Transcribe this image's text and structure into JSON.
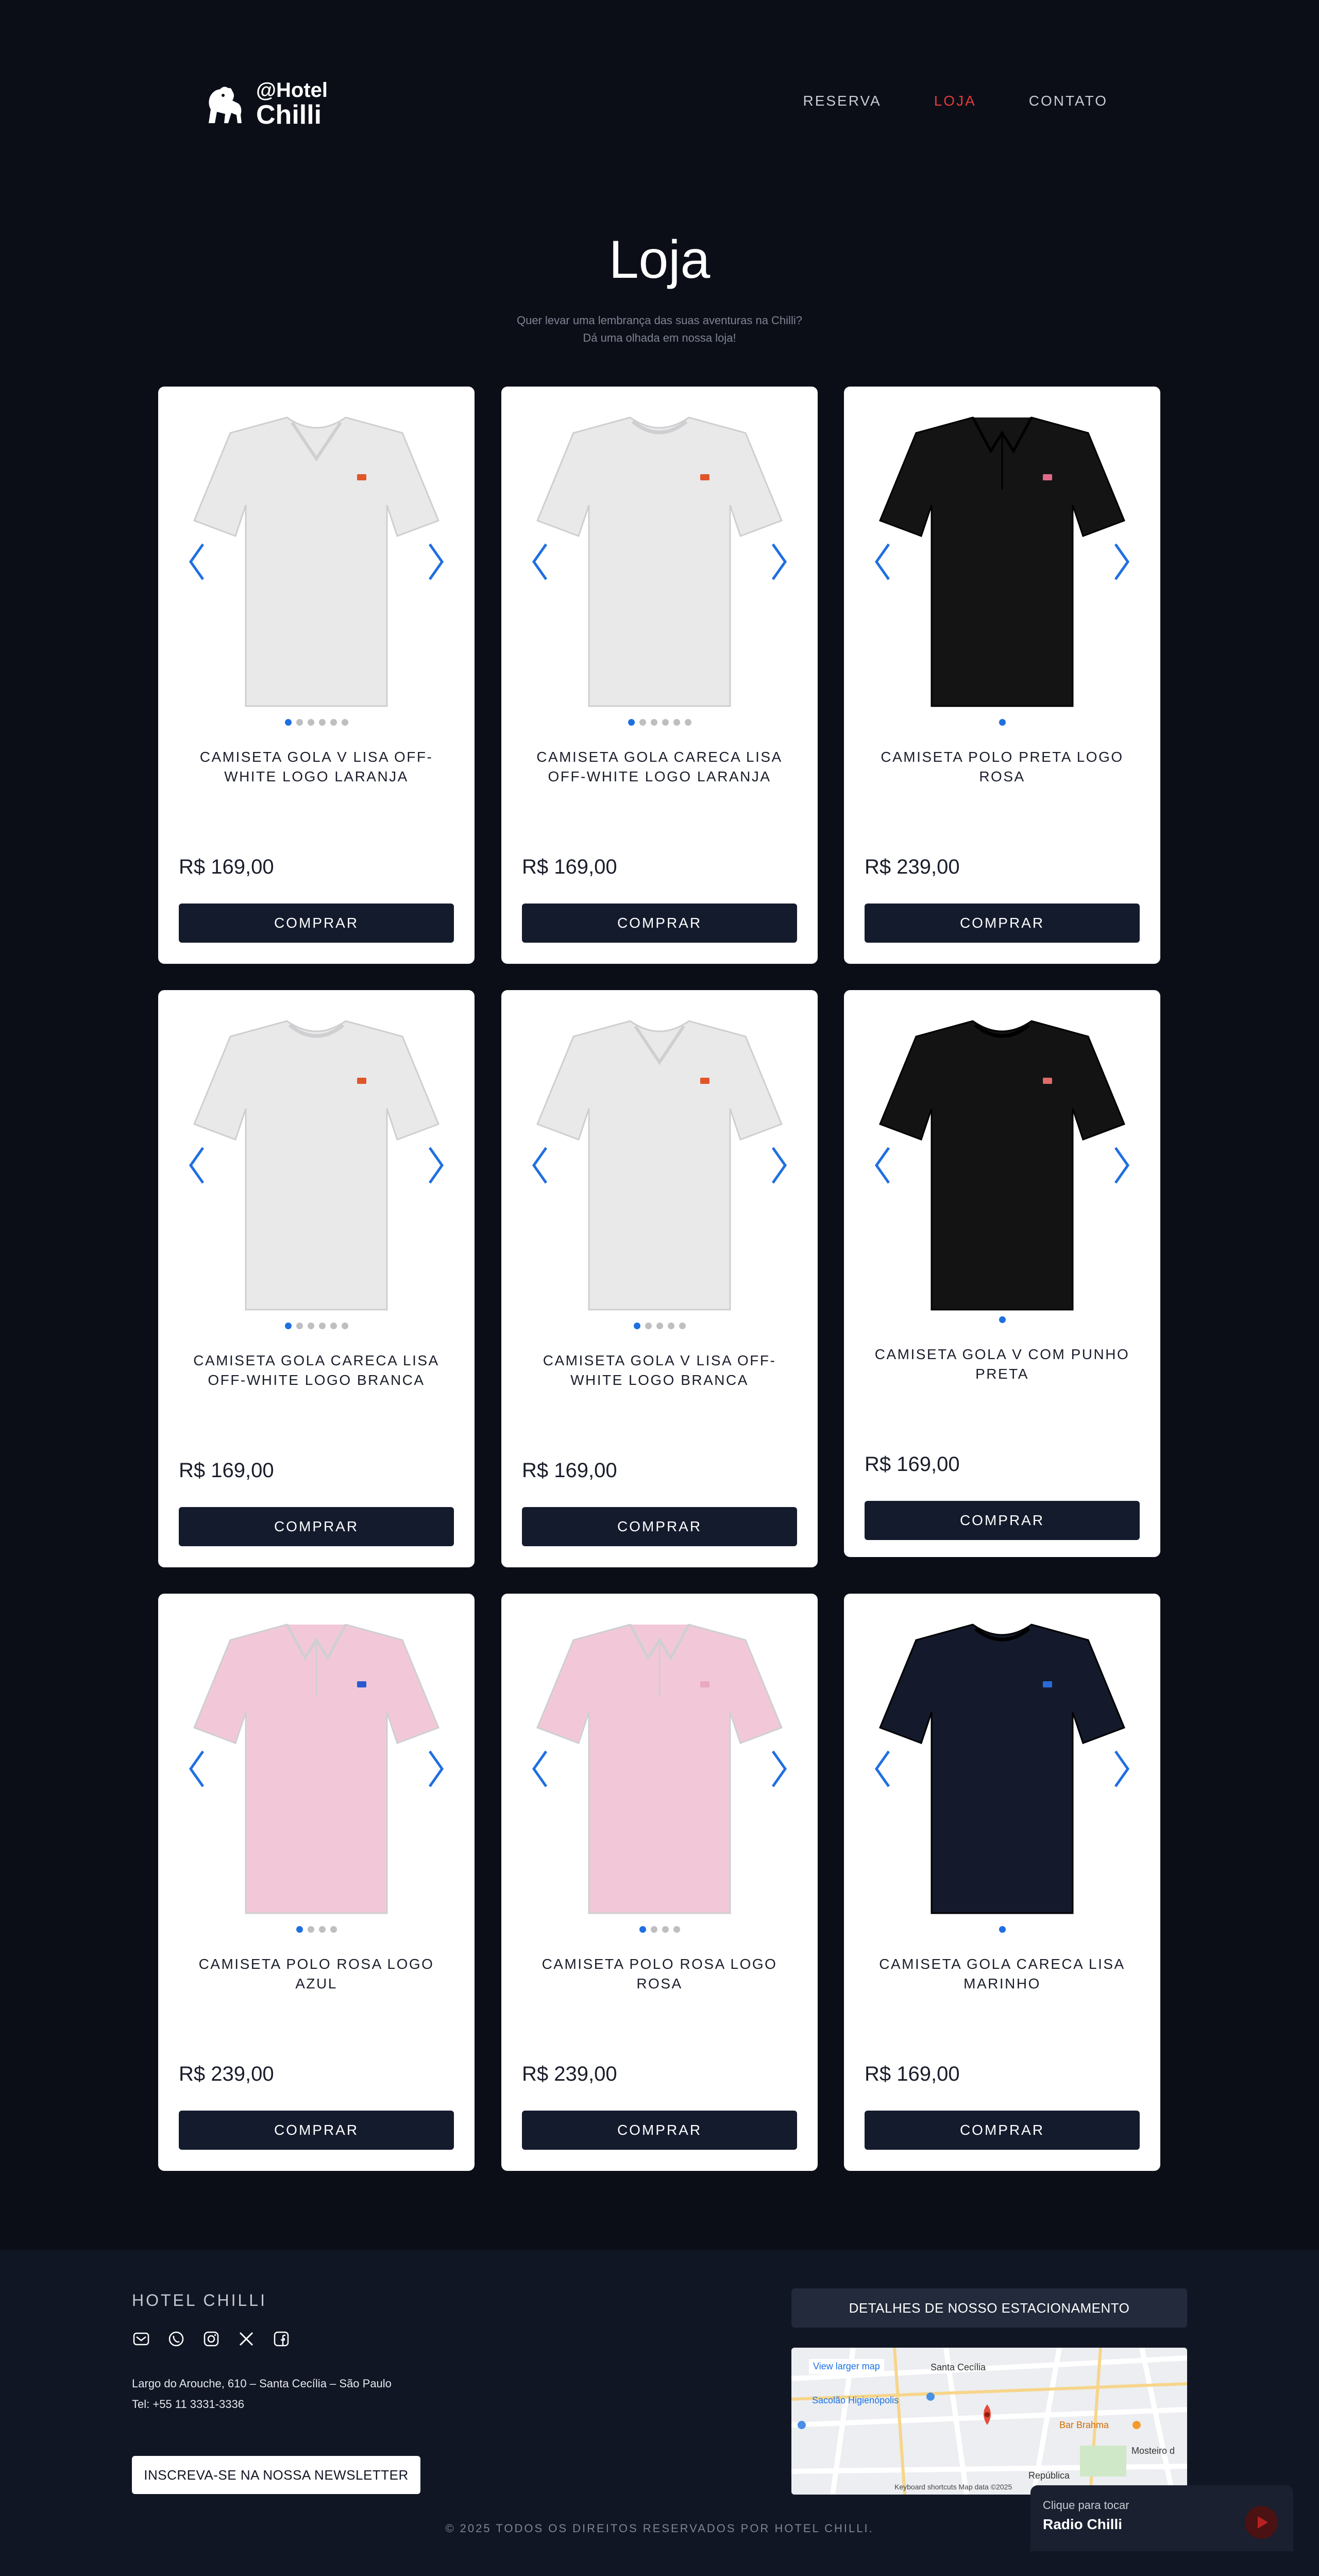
{
  "header": {
    "logo": {
      "line1": "@Hotel",
      "line2": "Chilli"
    },
    "nav": [
      {
        "label": "RESERVA",
        "active": false
      },
      {
        "label": "LOJA",
        "active": true
      },
      {
        "label": "CONTATO",
        "active": false
      }
    ]
  },
  "hero": {
    "title": "Loja",
    "subtitle_line1": "Quer levar uma lembrança das suas aventuras na Chilli?",
    "subtitle_line2": "Dá uma olhada em nossa loja!"
  },
  "products": [
    {
      "name": "CAMISETA GOLA V LISA OFF-WHITE LOGO LARANJA",
      "price": "R$ 169,00",
      "buy_label": "COMPRAR",
      "shirt_color": "#e9e9ea",
      "logo_color": "#e0562a",
      "dots": 6,
      "active_dot": 0
    },
    {
      "name": "CAMISETA GOLA CARECA LISA OFF-WHITE LOGO LARANJA",
      "price": "R$ 169,00",
      "buy_label": "COMPRAR",
      "shirt_color": "#e9e9ea",
      "logo_color": "#e0562a",
      "dots": 6,
      "active_dot": 0
    },
    {
      "name": "CAMISETA POLO PRETA LOGO ROSA",
      "price": "R$ 239,00",
      "buy_label": "COMPRAR",
      "shirt_color": "#141414",
      "logo_color": "#e06a8a",
      "dots": 1,
      "active_dot": 0
    },
    {
      "name": "CAMISETA GOLA CARECA LISA OFF-WHITE LOGO BRANCA",
      "price": "R$ 169,00",
      "buy_label": "COMPRAR",
      "shirt_color": "#e9e9ea",
      "logo_color": "#e0562a",
      "dots": 6,
      "active_dot": 0
    },
    {
      "name": "CAMISETA GOLA V LISA OFF-WHITE LOGO BRANCA",
      "price": "R$ 169,00",
      "buy_label": "COMPRAR",
      "shirt_color": "#e9e9ea",
      "logo_color": "#e0562a",
      "dots": 5,
      "active_dot": 0
    },
    {
      "name": "CAMISETA GOLA V COM PUNHO PRETA",
      "price": "R$ 169,00",
      "buy_label": "COMPRAR",
      "shirt_color": "#131313",
      "logo_color": "#e06a6a",
      "dots": 1,
      "active_dot": 0
    },
    {
      "name": "CAMISETA POLO ROSA LOGO AZUL",
      "price": "R$ 239,00",
      "buy_label": "COMPRAR",
      "shirt_color": "#f2c8d8",
      "logo_color": "#2a5ad0",
      "dots": 4,
      "active_dot": 0
    },
    {
      "name": "CAMISETA POLO ROSA LOGO ROSA",
      "price": "R$ 239,00",
      "buy_label": "COMPRAR",
      "shirt_color": "#f2c8d8",
      "logo_color": "#e9a9c0",
      "dots": 4,
      "active_dot": 0
    },
    {
      "name": "CAMISETA GOLA CARECA LISA MARINHO",
      "price": "R$ 169,00",
      "buy_label": "COMPRAR",
      "shirt_color": "#141a2c",
      "logo_color": "#2a6ad8",
      "dots": 1,
      "active_dot": 0
    }
  ],
  "footer": {
    "brand": "HOTEL CHILLI",
    "social_icons": [
      "mail-icon",
      "whatsapp-icon",
      "instagram-icon",
      "x-icon",
      "facebook-icon"
    ],
    "address": "Largo do Arouche, 610 – Santa Cecília – São Paulo",
    "phone": "Tel: +55 11 3331-3336",
    "newsletter_label": "INSCREVA-SE NA NOSSA NEWSLETTER",
    "parking_label": "DETALHES DE NOSSO ESTACIONAMENTO",
    "map": {
      "view_larger": "View larger map",
      "labels": [
        "Santa Cecília",
        "Sacolão Higienópolis",
        "Bar Brahma",
        "República",
        "Mosteiro d"
      ],
      "attribution": "Keyboard shortcuts   Map data ©2025"
    },
    "copyright": "© 2025 TODOS OS DIREITOS RESERVADOS POR HOTEL CHILLI."
  },
  "radio": {
    "hint": "Clique para tocar",
    "title": "Radio Chilli"
  },
  "colors": {
    "background": "#0b0e17",
    "button": "#141b2d",
    "accent_active": "#e23a3a",
    "carousel_blue": "#1f6fe0"
  }
}
